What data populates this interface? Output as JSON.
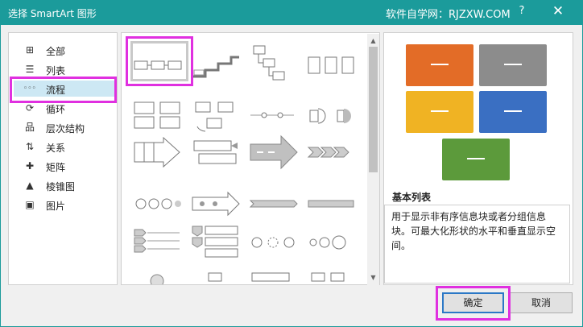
{
  "window": {
    "title": "选择 SmartArt 图形",
    "site": "软件自学网：RJZXW.COM",
    "help": "?",
    "close": "✕"
  },
  "categories": [
    {
      "label": "全部",
      "icon": "all-icon"
    },
    {
      "label": "列表",
      "icon": "list-icon"
    },
    {
      "label": "流程",
      "icon": "process-icon",
      "selected": true
    },
    {
      "label": "循环",
      "icon": "cycle-icon"
    },
    {
      "label": "层次结构",
      "icon": "hierarchy-icon"
    },
    {
      "label": "关系",
      "icon": "relationship-icon"
    },
    {
      "label": "矩阵",
      "icon": "matrix-icon"
    },
    {
      "label": "棱锥图",
      "icon": "pyramid-icon"
    },
    {
      "label": "图片",
      "icon": "picture-icon"
    }
  ],
  "preview": {
    "colors": [
      "#e36c27",
      "#8c8c8c",
      "#f0b323",
      "#3a6fc2",
      "#5c9a3b"
    ],
    "title": "基本列表",
    "description": "用于显示非有序信息块或者分组信息块。可最大化形状的水平和垂直显示空间。"
  },
  "buttons": {
    "ok": "确定",
    "cancel": "取消"
  }
}
